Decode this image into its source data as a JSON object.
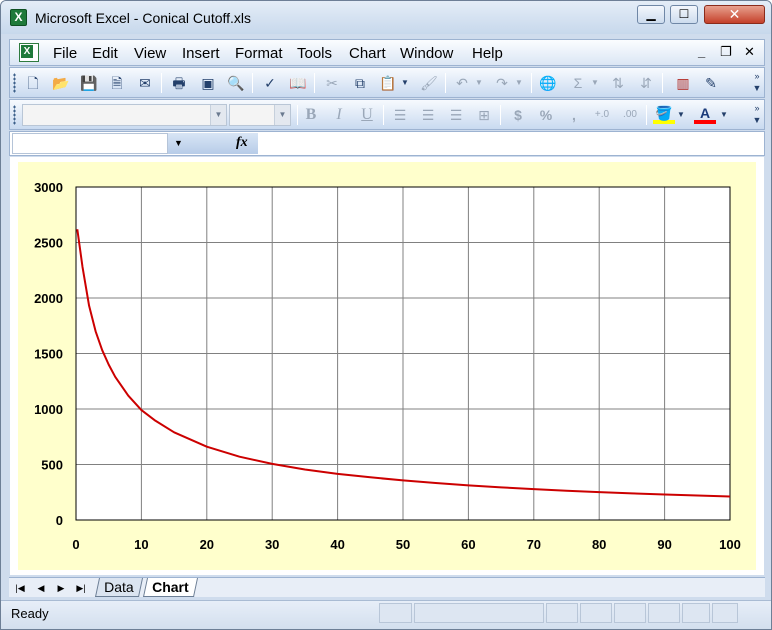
{
  "window": {
    "title": "Microsoft Excel - Conical Cutoff.xls",
    "app_icon": "X"
  },
  "menu": {
    "items": [
      "File",
      "Edit",
      "View",
      "Insert",
      "Format",
      "Tools",
      "Chart",
      "Window",
      "Help"
    ],
    "mdi_minimize": "_",
    "mdi_restore": "❐",
    "mdi_close": "✕"
  },
  "formula_bar": {
    "fx_label": "fx",
    "name_box": "",
    "formula": ""
  },
  "chart_data": {
    "type": "line",
    "title": "",
    "xlabel": "",
    "ylabel": "",
    "xlim": [
      0,
      100
    ],
    "ylim": [
      0,
      3000
    ],
    "x_ticks": [
      0,
      10,
      20,
      30,
      40,
      50,
      60,
      70,
      80,
      90,
      100
    ],
    "y_ticks": [
      0,
      500,
      1000,
      1500,
      2000,
      2500,
      3000
    ],
    "grid": true,
    "legend": "none",
    "series": [
      {
        "color": "#cc0000",
        "x": [
          0.2,
          1,
          2,
          3,
          4,
          5,
          6,
          8,
          10,
          12,
          15,
          20,
          25,
          30,
          35,
          40,
          45,
          50,
          55,
          60,
          65,
          70,
          75,
          80,
          85,
          90,
          95,
          100
        ],
        "y": [
          2620,
          2280,
          1930,
          1700,
          1530,
          1400,
          1290,
          1120,
          990,
          900,
          790,
          660,
          570,
          505,
          455,
          415,
          385,
          357,
          333,
          312,
          294,
          278,
          264,
          251,
          240,
          230,
          221,
          212
        ]
      }
    ]
  },
  "sheets": {
    "tabs": [
      "Data",
      "Chart"
    ],
    "active": "Chart"
  },
  "status": {
    "text": "Ready"
  },
  "colors": {
    "chart_area": "#ffffcc",
    "line": "#cc0000",
    "grid": "#808080"
  }
}
